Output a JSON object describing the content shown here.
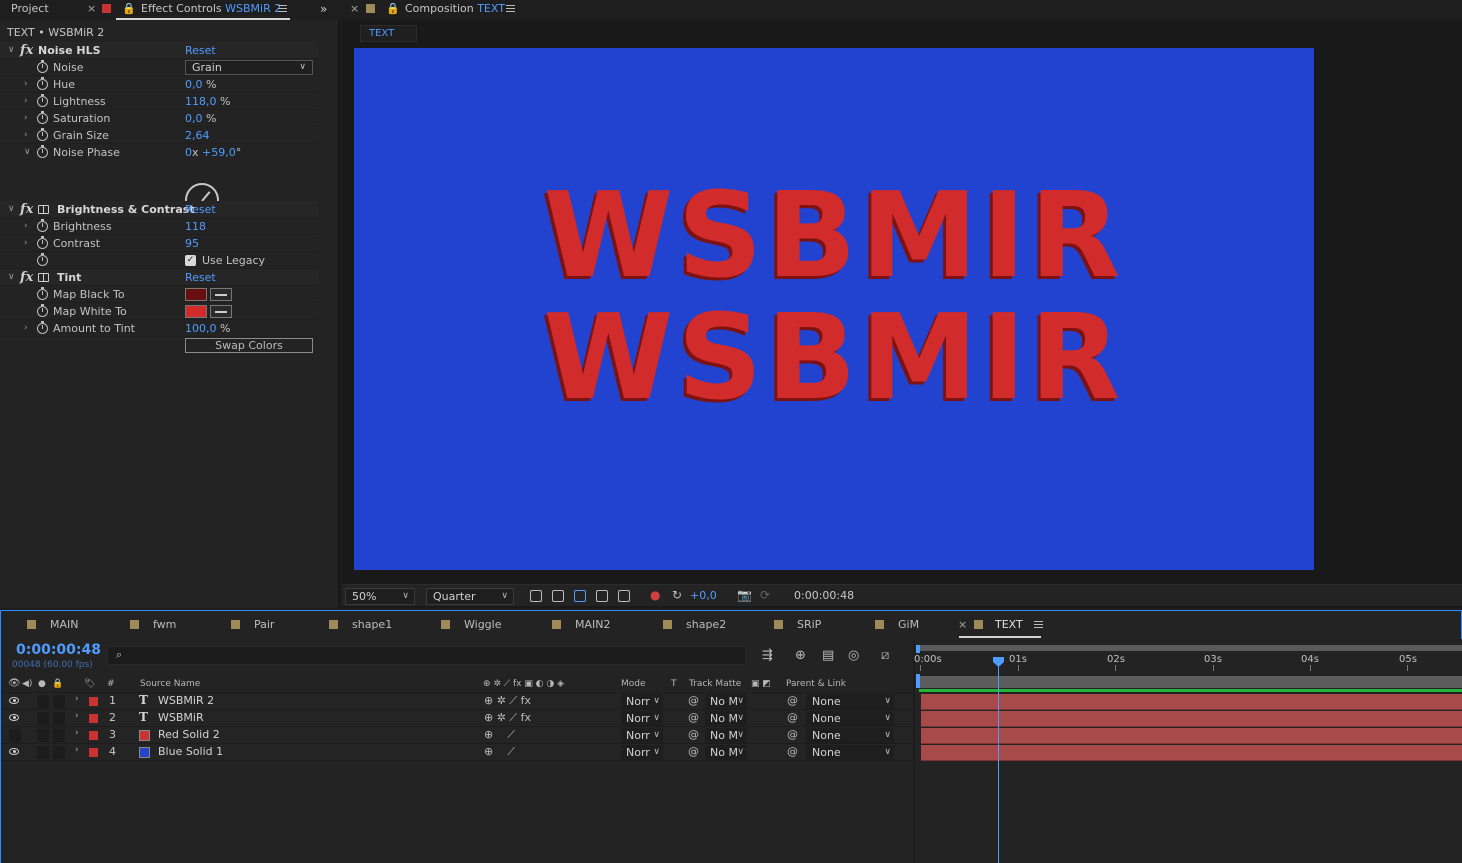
{
  "left_tabs": {
    "project": "Project",
    "effect_controls_prefix": "Effect Controls",
    "effect_controls_layer": "WSBMiR 2"
  },
  "effect_panel": {
    "breadcrumb": "TEXT • WSBMiR 2",
    "noise_hls": {
      "name": "Noise HLS",
      "reset": "Reset",
      "props": [
        {
          "label": "Noise",
          "value": "Grain"
        },
        {
          "label": "Hue",
          "value": "0,0",
          "unit": "%"
        },
        {
          "label": "Lightness",
          "value": "118,0",
          "unit": "%"
        },
        {
          "label": "Saturation",
          "value": "0,0",
          "unit": "%"
        },
        {
          "label": "Grain Size",
          "value": "2,64"
        },
        {
          "label": "Noise Phase",
          "value": "0",
          "value_b": "+59,0",
          "unit_a": "x",
          "unit_b": "°"
        }
      ]
    },
    "brightness_contrast": {
      "name": "Brightness & Contrast",
      "reset": "Reset",
      "props": [
        {
          "label": "Brightness",
          "value": "118"
        },
        {
          "label": "Contrast",
          "value": "95"
        }
      ],
      "legacy_checkbox": "Use Legacy (supports"
    },
    "tint": {
      "name": "Tint",
      "reset": "Reset",
      "props": [
        {
          "label": "Map Black To",
          "color": "#6a0f0f"
        },
        {
          "label": "Map White To",
          "color": "#d12b2b"
        },
        {
          "label": "Amount to Tint",
          "value": "100,0",
          "unit": "%"
        }
      ],
      "swap_button": "Swap Colors"
    }
  },
  "comp_tabs": {
    "prefix": "Composition",
    "name": "TEXT",
    "chip": "TEXT"
  },
  "composition": {
    "bg_color": "#2243cf",
    "lines": [
      "WSBMIR",
      "WSBMIR"
    ]
  },
  "comp_toolbar": {
    "zoom": "50%",
    "resolution": "Quarter",
    "exposure": "+0,0",
    "timecode": "0:00:00:48"
  },
  "timeline_tabs": [
    "MAIN",
    "fwm",
    "Pair",
    "shape1",
    "Wiggle",
    "MAIN2",
    "shape2",
    "SRiP",
    "GiM",
    "TEXT"
  ],
  "timeline": {
    "timecode": "0:00:00:48",
    "fps": "00048 (60.00 fps)",
    "headers": {
      "hash": "#",
      "source_name": "Source Name",
      "mode": "Mode",
      "t": "T",
      "track_matte": "Track Matte",
      "parent": "Parent & Link"
    },
    "ruler": [
      "0:00s",
      "01s",
      "02s",
      "03s",
      "04s",
      "05s"
    ],
    "layers": [
      {
        "num": "1",
        "name": "WSBMiR 2",
        "type": "text",
        "mode": "Norr",
        "matte": "No M",
        "parent": "None"
      },
      {
        "num": "2",
        "name": "WSBMiR",
        "type": "text",
        "mode": "Norr",
        "matte": "No M",
        "parent": "None"
      },
      {
        "num": "3",
        "name": "Red Solid 2",
        "type": "solid",
        "solid_color": "#c93333",
        "mode": "Norr",
        "matte": "No M",
        "parent": "None"
      },
      {
        "num": "4",
        "name": "Blue Solid 1",
        "type": "solid",
        "solid_color": "#2445c9",
        "mode": "Norr",
        "matte": "No M",
        "parent": "None"
      }
    ]
  }
}
